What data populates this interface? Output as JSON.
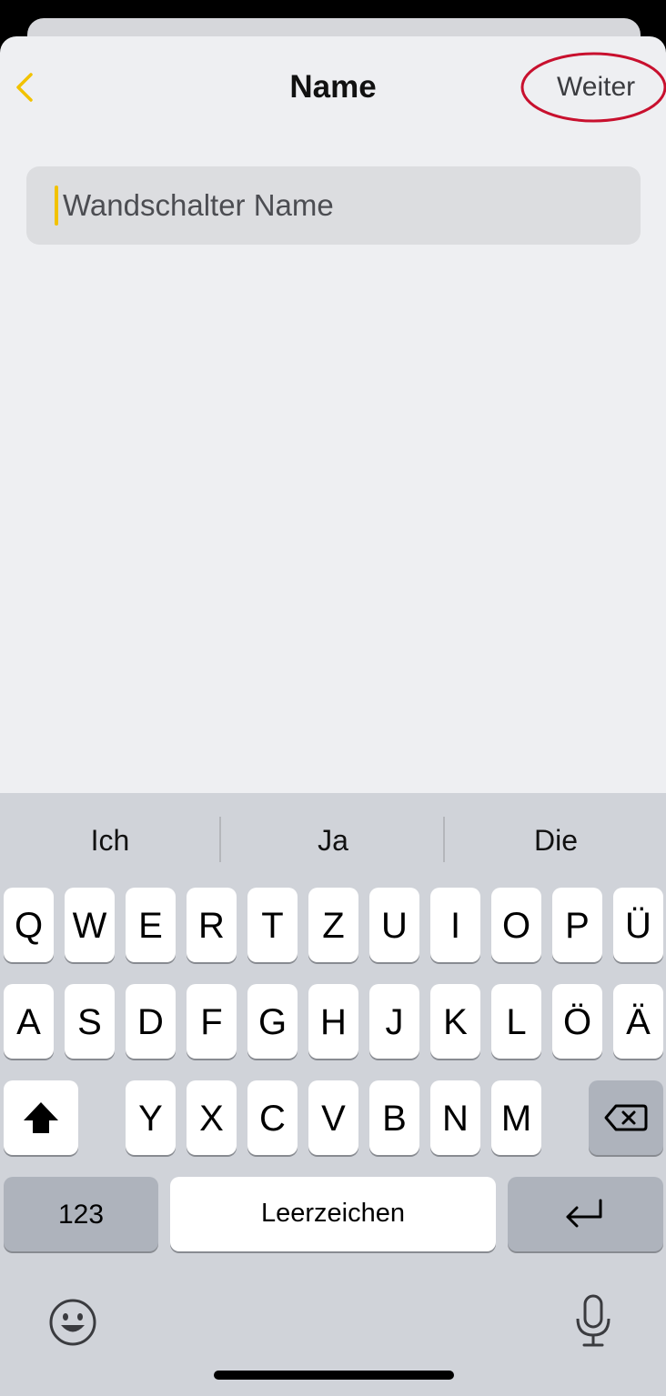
{
  "header": {
    "title": "Name",
    "next_label": "Weiter"
  },
  "name_field": {
    "placeholder": "Wandschalter Name",
    "value": ""
  },
  "keyboard": {
    "suggestions": [
      "Ich",
      "Ja",
      "Die"
    ],
    "row1": [
      "Q",
      "W",
      "E",
      "R",
      "T",
      "Z",
      "U",
      "I",
      "O",
      "P",
      "Ü"
    ],
    "row2": [
      "A",
      "S",
      "D",
      "F",
      "G",
      "H",
      "J",
      "K",
      "L",
      "Ö",
      "Ä"
    ],
    "row3": [
      "Y",
      "X",
      "C",
      "V",
      "B",
      "N",
      "M"
    ],
    "numbers_label": "123",
    "space_label": "Leerzeichen"
  },
  "colors": {
    "accent": "#f2c200",
    "highlight": "#c8102e"
  },
  "icons": {
    "back": "chevron-left-icon",
    "shift": "shift-icon",
    "backspace": "backspace-icon",
    "return": "return-icon",
    "emoji": "emoji-icon",
    "microphone": "microphone-icon"
  }
}
